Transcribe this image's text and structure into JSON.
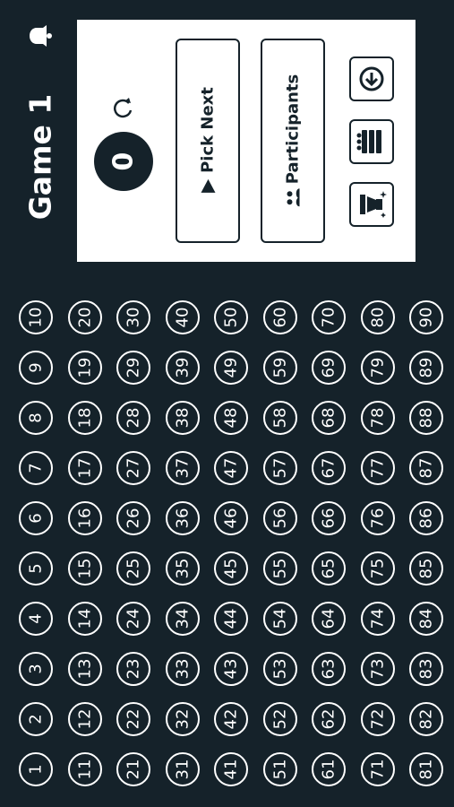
{
  "header": {
    "title": "Game 1",
    "bell_icon": "bell-icon"
  },
  "panel": {
    "counter_value": "0",
    "reset_icon": "refresh-icon",
    "pick_next_label": "Pick Next",
    "participants_label": "Participants",
    "actions": [
      {
        "name": "download-icon"
      },
      {
        "name": "players-icon"
      },
      {
        "name": "winner-icon"
      }
    ]
  },
  "board": {
    "numbers": [
      "1",
      "2",
      "3",
      "4",
      "5",
      "6",
      "7",
      "8",
      "9",
      "10",
      "11",
      "12",
      "13",
      "14",
      "15",
      "16",
      "17",
      "18",
      "19",
      "20",
      "21",
      "22",
      "23",
      "24",
      "25",
      "26",
      "27",
      "28",
      "29",
      "30",
      "31",
      "32",
      "33",
      "34",
      "35",
      "36",
      "37",
      "38",
      "39",
      "40",
      "41",
      "42",
      "43",
      "44",
      "45",
      "46",
      "47",
      "48",
      "49",
      "50",
      "51",
      "52",
      "53",
      "54",
      "55",
      "56",
      "57",
      "58",
      "59",
      "60",
      "61",
      "62",
      "63",
      "64",
      "65",
      "66",
      "67",
      "68",
      "69",
      "70",
      "71",
      "72",
      "73",
      "74",
      "75",
      "76",
      "77",
      "78",
      "79",
      "80",
      "81",
      "82",
      "83",
      "84",
      "85",
      "86",
      "87",
      "88",
      "89",
      "90"
    ]
  },
  "colors": {
    "background": "#15222a",
    "panel": "#ffffff",
    "accent": "#15222a"
  }
}
